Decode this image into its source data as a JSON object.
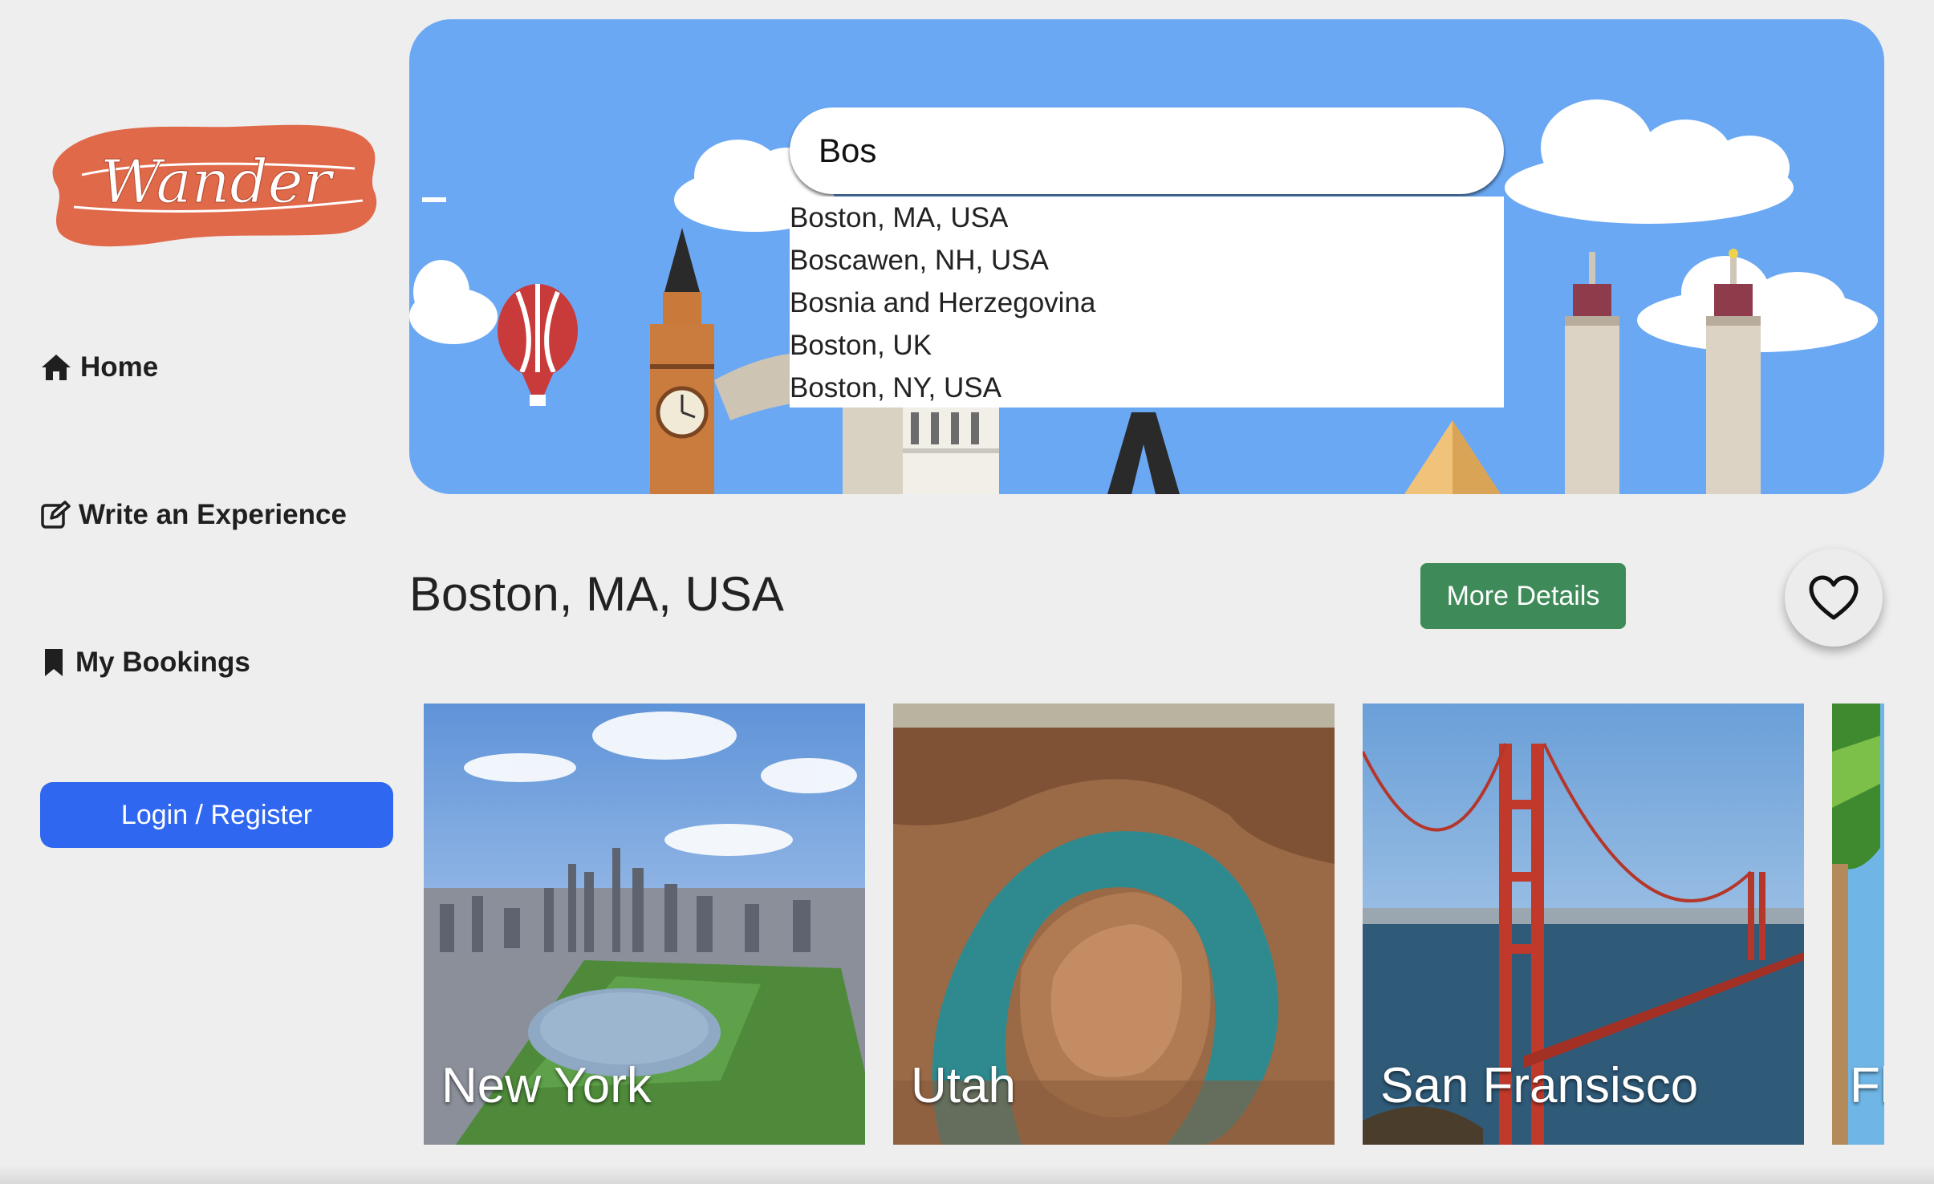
{
  "logo": {
    "text": "Wander",
    "color": "#e0694a"
  },
  "sidebar": {
    "items": [
      {
        "label": "Home",
        "icon": "home-icon"
      },
      {
        "label": "Write an Experience",
        "icon": "edit-icon"
      },
      {
        "label": "My Bookings",
        "icon": "bookmark-icon"
      }
    ],
    "login_label": "Login / Register"
  },
  "search": {
    "value": "Bos",
    "suggestions": [
      "Boston, MA, USA",
      "Boscawen, NH, USA",
      "Bosnia and Herzegovina",
      "Boston, UK",
      "Boston, NY, USA"
    ]
  },
  "result": {
    "title": "Boston, MA, USA",
    "more_details_label": "More Details",
    "favorite_icon": "heart-icon"
  },
  "destinations": [
    {
      "label": "New York"
    },
    {
      "label": "Utah"
    },
    {
      "label": "San Fransisco"
    },
    {
      "label": "Fl"
    }
  ],
  "colors": {
    "background": "#eeeeee",
    "hero_sky": "#6ba8f4",
    "login_button": "#2f67f0",
    "more_details_button": "#3e8a58"
  }
}
